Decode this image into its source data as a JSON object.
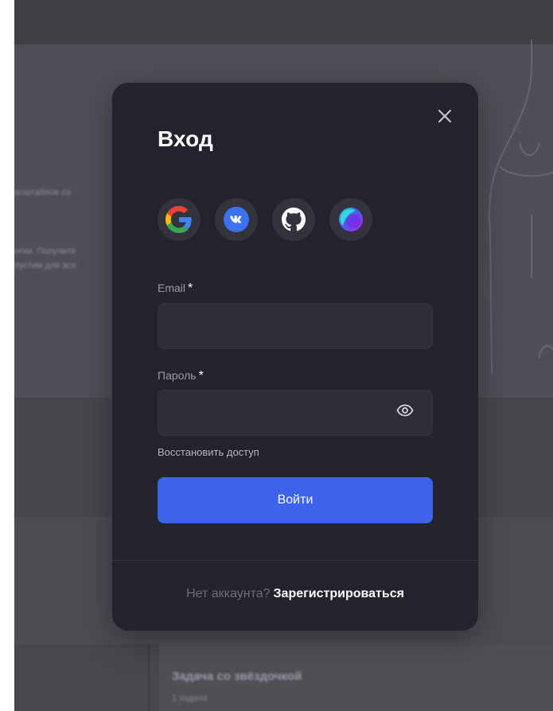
{
  "modal": {
    "title": "Вход",
    "social": [
      {
        "name": "google",
        "icon": "google-icon"
      },
      {
        "name": "vk",
        "icon": "vk-icon"
      },
      {
        "name": "github",
        "icon": "github-icon"
      },
      {
        "name": "other",
        "icon": "gradient-ring-icon"
      }
    ],
    "email": {
      "label": "Email",
      "required_mark": "*",
      "value": "",
      "placeholder": ""
    },
    "password": {
      "label": "Пароль",
      "required_mark": "*",
      "value": "",
      "placeholder": ""
    },
    "restore_link": "Восстановить доступ",
    "submit_label": "Войти",
    "footer": {
      "prompt": "Нет аккаунта?",
      "register_link": "Зарегистрироваться"
    }
  },
  "background": {
    "hero_line1": "асштабное со",
    "hero_line2": "огии. Получите",
    "hero_line3": "пустим для все",
    "task_title": "Задача со звёздочкой",
    "task_sub": "1 задача"
  },
  "colors": {
    "modal_bg": "#23232d",
    "accent": "#3d63ed",
    "input_bg": "#2e2e39"
  }
}
